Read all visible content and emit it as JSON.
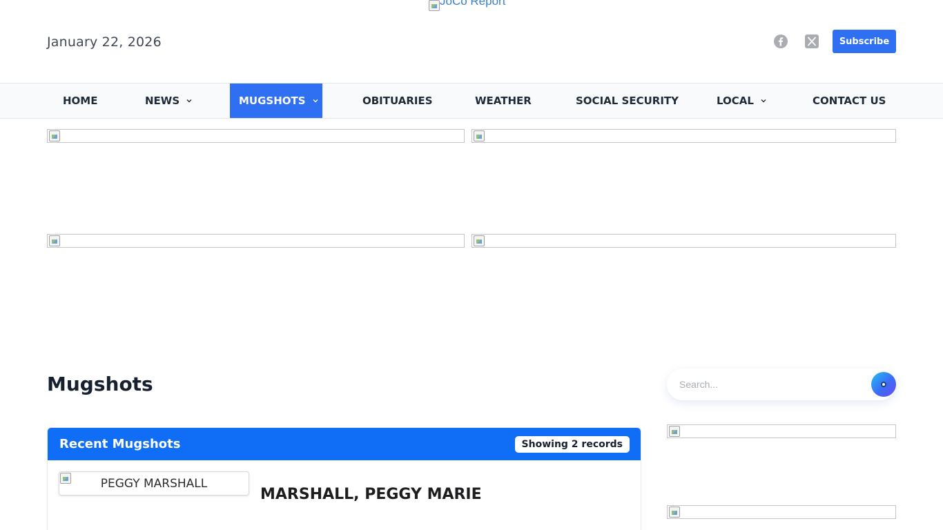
{
  "header": {
    "logo_alt": "JoCo Report",
    "date": "January 22, 2026",
    "social": [
      {
        "icon": "facebook-icon"
      },
      {
        "icon": "x-twitter-icon"
      }
    ],
    "subscribe_label": "Subscribe"
  },
  "nav": {
    "items": [
      {
        "label": "HOME",
        "dropdown": false,
        "active": false
      },
      {
        "label": "NEWS",
        "dropdown": true,
        "active": false
      },
      {
        "label": "MUGSHOTS",
        "dropdown": true,
        "active": true
      },
      {
        "label": "OBITUARIES",
        "dropdown": false,
        "active": false
      },
      {
        "label": "WEATHER",
        "dropdown": false,
        "active": false
      },
      {
        "label": "SOCIAL SECURITY",
        "dropdown": false,
        "active": false
      },
      {
        "label": "LOCAL",
        "dropdown": true,
        "active": false
      },
      {
        "label": "CONTACT US",
        "dropdown": false,
        "active": false
      }
    ]
  },
  "main": {
    "page_title": "Mugshots",
    "panel": {
      "title": "Recent Mugshots",
      "badge": "Showing 2 records",
      "records": [
        {
          "image_alt": "PEGGY MARSHALL",
          "name": "MARSHALL, PEGGY MARIE"
        }
      ]
    }
  },
  "sidebar": {
    "search_placeholder": "Search..."
  },
  "colors": {
    "accent": "#2f6ff2",
    "panel_header": "#0f6ef5",
    "nav_background": "#f8fafc",
    "icon_gray": "#a9acb1"
  }
}
